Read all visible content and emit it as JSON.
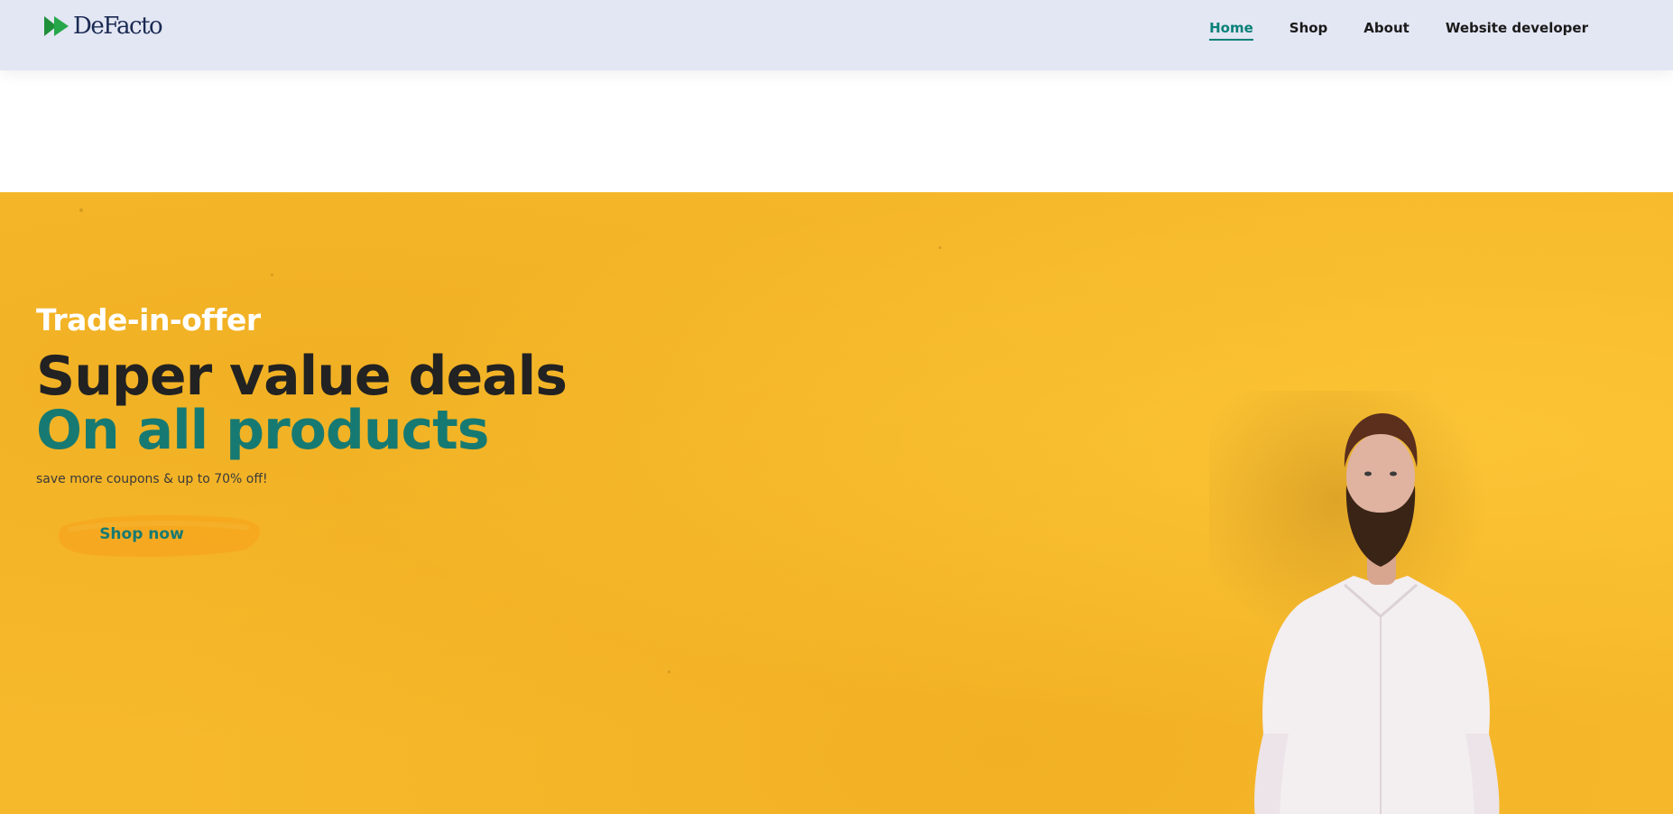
{
  "header": {
    "logo_text": "DeFacto",
    "nav": [
      {
        "label": "Home",
        "active": true
      },
      {
        "label": "Shop",
        "active": false
      },
      {
        "label": "About",
        "active": false
      },
      {
        "label": "Website developer",
        "active": false
      }
    ]
  },
  "hero": {
    "eyebrow": "Trade-in-offer",
    "headline": "Super value deals",
    "subheadline": "On all products",
    "tagline": "save more coupons & up to 70% off!",
    "cta_label": "Shop now"
  },
  "colors": {
    "accent": "#088178",
    "header_bg": "#e3e6f3",
    "hero_bg": "#f7b92c"
  }
}
